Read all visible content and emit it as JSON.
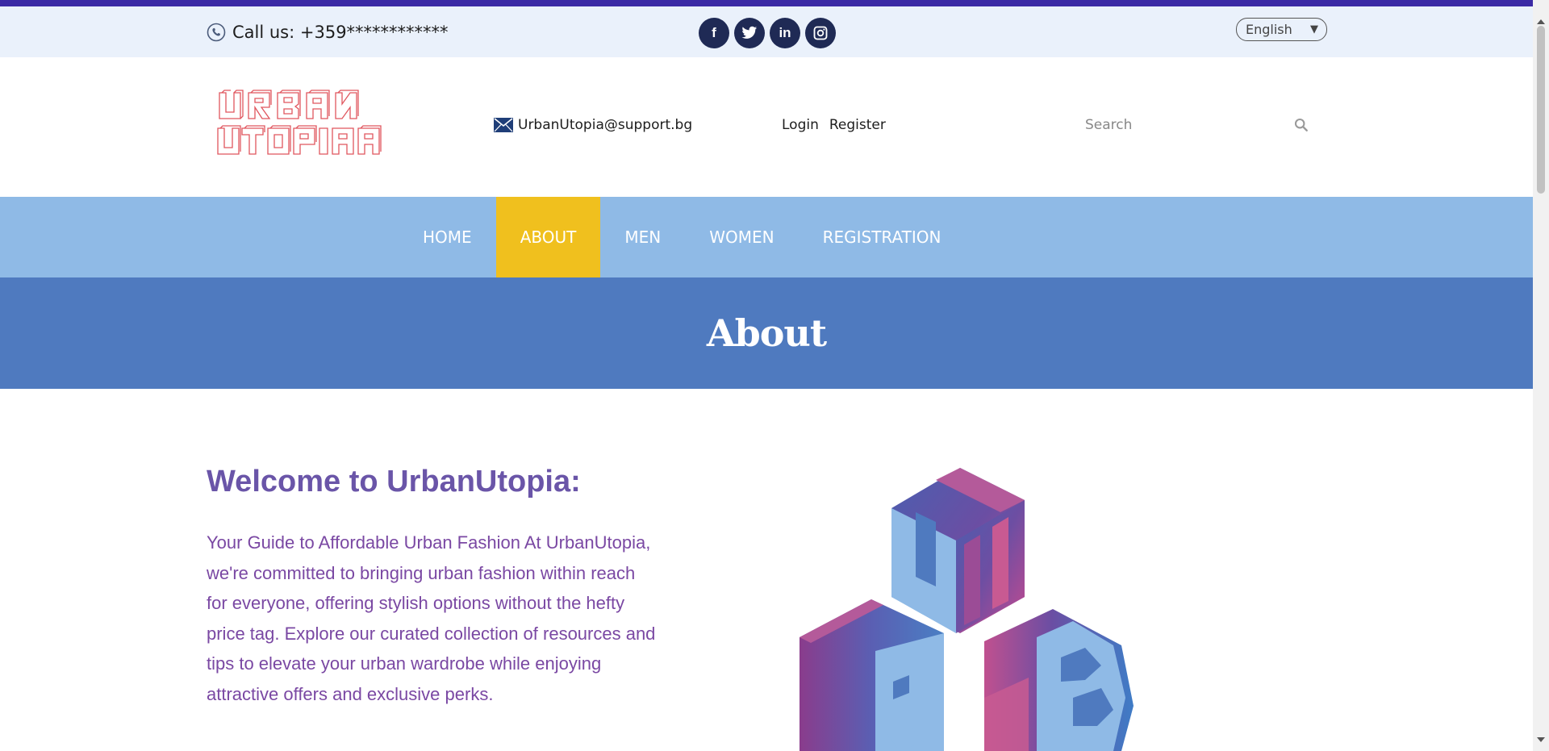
{
  "topbar": {
    "call_text": "Call us: +359************",
    "socials": [
      "f",
      "t",
      "in",
      "ig"
    ],
    "language": "English"
  },
  "header": {
    "email": "UrbanUtopia@support.bg",
    "login": "Login",
    "register": "Register",
    "search_placeholder": "Search"
  },
  "nav": {
    "items": [
      "HOME",
      "ABOUT",
      "MEN",
      "WOMEN",
      "REGISTRATION"
    ],
    "active": "ABOUT"
  },
  "banner": {
    "title": "About"
  },
  "main": {
    "welcome": "Welcome to UrbanUtopia:",
    "intro": "Your Guide to Affordable Urban Fashion At UrbanUtopia, we're committed to bringing urban fashion within reach for everyone, offering stylish options without the hefty price tag. Explore our curated collection of resources and tips to elevate your urban wardrobe while enjoying attractive offers and exclusive perks."
  },
  "colors": {
    "accent_line": "#3b2aa5",
    "nav_bg": "#8fbae6",
    "nav_active": "#f0c01e",
    "banner_bg": "#4f7abf",
    "heading": "#6a55a8",
    "body_text": "#7a48a3",
    "social_bg": "#1f2a55"
  }
}
